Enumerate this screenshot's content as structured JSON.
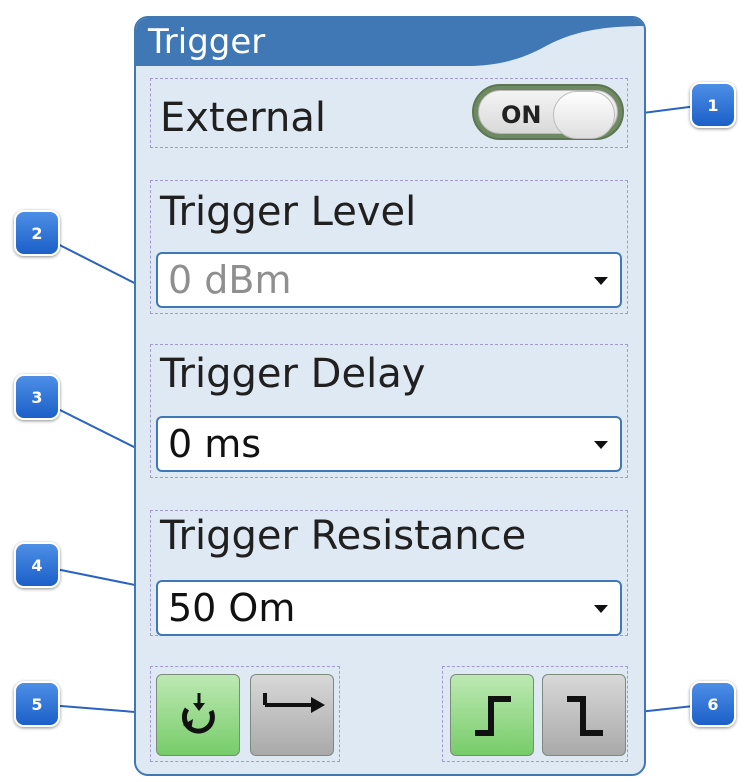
{
  "panel": {
    "title": "Trigger"
  },
  "external": {
    "label": "External",
    "toggle_text": "ON",
    "state": "on"
  },
  "trigger_level": {
    "label": "Trigger Level",
    "value": "0 dBm"
  },
  "trigger_delay": {
    "label": "Trigger Delay",
    "value": "0 ms"
  },
  "trigger_resistance": {
    "label": "Trigger Resistance",
    "value": "50 Om"
  },
  "mode_buttons": [
    {
      "icon": "loop-icon",
      "state": "active"
    },
    {
      "icon": "single-arrow-icon",
      "state": "inactive"
    }
  ],
  "edge_buttons": [
    {
      "icon": "rising-edge-icon",
      "state": "active"
    },
    {
      "icon": "falling-edge-icon",
      "state": "inactive"
    }
  ],
  "callouts": [
    "1",
    "2",
    "3",
    "4",
    "5",
    "6"
  ],
  "colors": {
    "accent": "#3f78b4",
    "panel_bg": "#dfe9f4",
    "active_green": "#77cc69",
    "badge_blue": "#1c5fc8"
  }
}
